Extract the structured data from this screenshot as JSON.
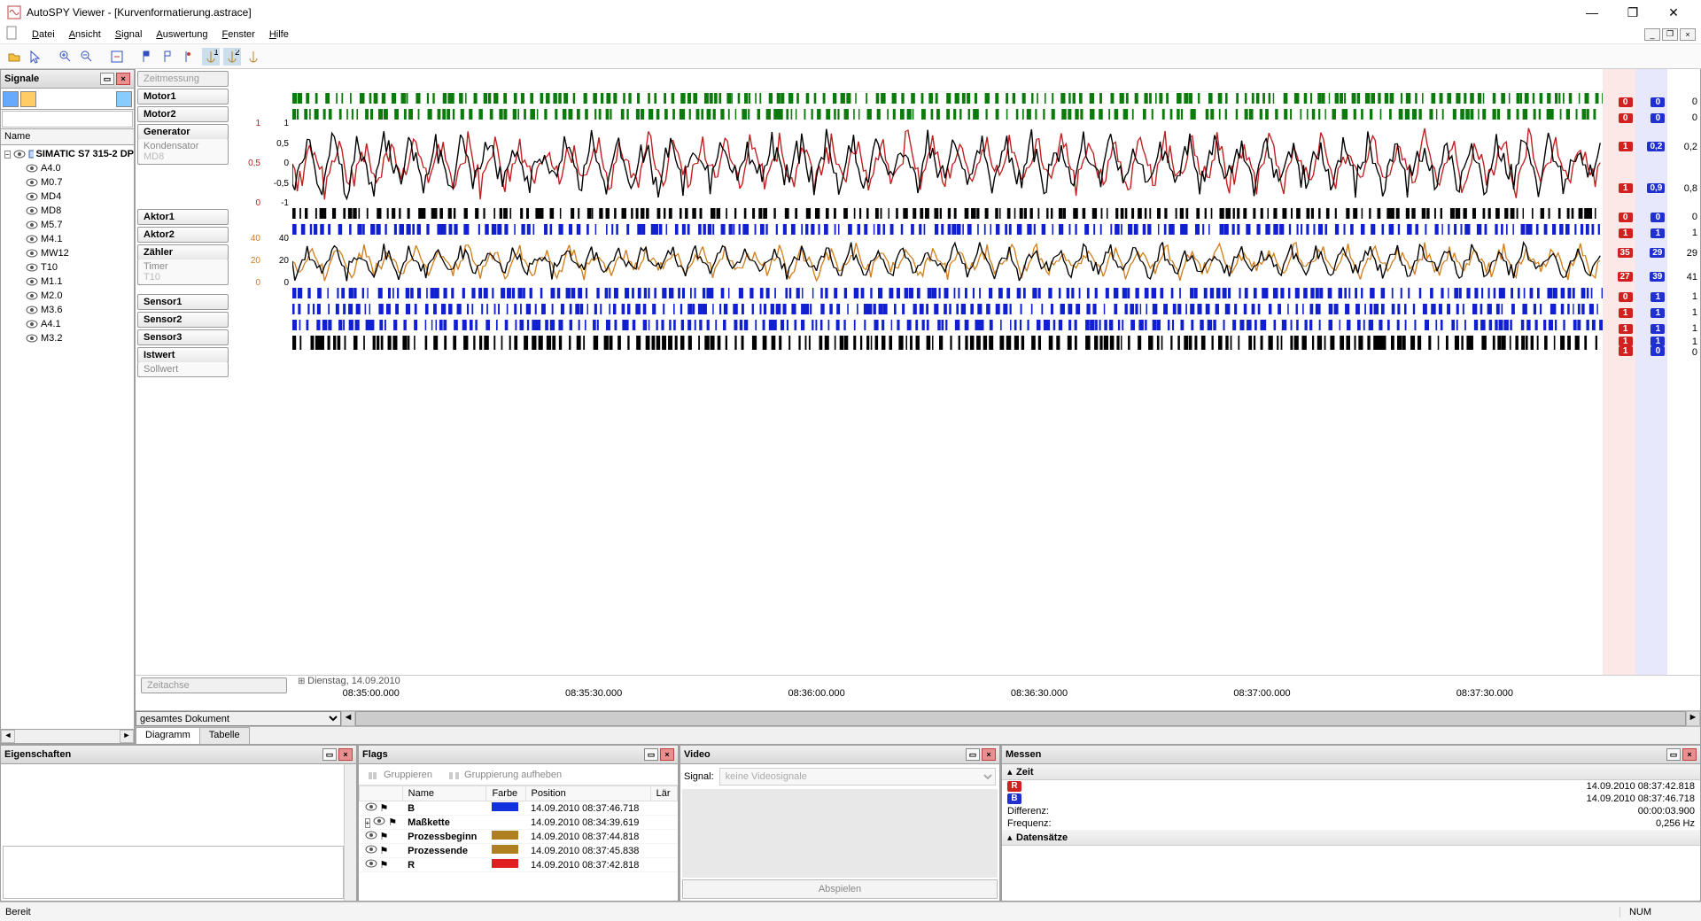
{
  "window": {
    "title": "AutoSPY Viewer - [Kurvenformatierung.astrace]"
  },
  "menu": [
    "Datei",
    "Ansicht",
    "Signal",
    "Auswertung",
    "Fenster",
    "Hilfe"
  ],
  "panels": {
    "signals": {
      "title": "Signale",
      "nameCol": "Name",
      "root": "SIMATIC S7 315-2 DP",
      "items": [
        "A4.0",
        "M0.7",
        "MD4",
        "MD8",
        "M5.7",
        "M4.1",
        "MW12",
        "T10",
        "M1.1",
        "M2.0",
        "M3.6",
        "A4.1",
        "M3.2"
      ]
    },
    "props": {
      "title": "Eigenschaften"
    },
    "flags": {
      "title": "Flags",
      "toolbar": {
        "group": "Gruppieren",
        "ungroup": "Gruppierung aufheben"
      },
      "cols": [
        "Name",
        "Farbe",
        "Position",
        "Lär"
      ],
      "rows": [
        {
          "name": "B",
          "color": "#1030e0",
          "pos": "14.09.2010  08:37:46.718"
        },
        {
          "name": "Maßkette",
          "color": "",
          "pos": "14.09.2010  08:34:39.619",
          "exp": true
        },
        {
          "name": "Prozessbeginn",
          "color": "#b08020",
          "pos": "14.09.2010  08:37:44.818"
        },
        {
          "name": "Prozessende",
          "color": "#b08020",
          "pos": "14.09.2010  08:37:45.838"
        },
        {
          "name": "R",
          "color": "#e02020",
          "pos": "14.09.2010  08:37:42.818"
        }
      ]
    },
    "video": {
      "title": "Video",
      "signalLbl": "Signal:",
      "noSignal": "keine Videosignale",
      "play": "Abspielen"
    },
    "mess": {
      "title": "Messen",
      "zeit": "Zeit",
      "r": {
        "label": "R",
        "val": "14.09.2010  08:37:42.818"
      },
      "b": {
        "label": "B",
        "val": "14.09.2010  08:37:46.718"
      },
      "diff": {
        "label": "Differenz:",
        "val": "00:00:03.900"
      },
      "freq": {
        "label": "Frequenz:",
        "val": "0,256 Hz"
      },
      "data": "Datensätze"
    }
  },
  "chart": {
    "zeitmessung": "Zeitmessung",
    "zeitachse": "Zeitachse",
    "dateLine": "Dienstag, 14.09.2010",
    "tracks": [
      {
        "label": "Motor1",
        "h": 14,
        "type": "dig",
        "color": "#0a7a0a",
        "vals": [
          "0",
          "0",
          "0"
        ]
      },
      {
        "label": "Motor2",
        "h": 14,
        "type": "dig",
        "color": "#0a7a0a",
        "vals": [
          "0",
          "0",
          "0"
        ]
      },
      {
        "label": "Generator",
        "sub": "Kondensator",
        "subnote": "MD8",
        "h": 90,
        "type": "ana",
        "axis": [
          "1",
          "0,5",
          "0",
          "-0,5",
          "-1"
        ],
        "axis2": [
          "1",
          "0,5",
          "0"
        ],
        "vals": [
          "1",
          "0,2",
          "0,2"
        ],
        "vals2": [
          "1",
          "0,9",
          "0,8"
        ]
      },
      {
        "label": "Aktor1",
        "h": 14,
        "type": "dig",
        "color": "#000",
        "vals": [
          "0",
          "0",
          "0"
        ]
      },
      {
        "label": "Aktor2",
        "h": 14,
        "type": "dig",
        "color": "#1020d0",
        "vals": [
          "1",
          "1",
          "1"
        ]
      },
      {
        "label": "Zähler",
        "sub": "Timer",
        "subnote": "T10",
        "h": 50,
        "type": "ana2",
        "axis": [
          "40",
          "20",
          "0"
        ],
        "axis2": [
          "40",
          "20",
          "0"
        ],
        "vals": [
          "35",
          "29",
          "29"
        ],
        "vals2": [
          "27",
          "39",
          "41"
        ]
      },
      {
        "label": "Sensor1",
        "h": 14,
        "type": "dig",
        "color": "#1020d0",
        "vals": [
          "0",
          "1",
          "1"
        ]
      },
      {
        "label": "Sensor2",
        "h": 14,
        "type": "dig",
        "color": "#1020d0",
        "vals": [
          "1",
          "1",
          "1"
        ]
      },
      {
        "label": "Sensor3",
        "h": 14,
        "type": "dig",
        "color": "#1020d0",
        "vals": [
          "1",
          "1",
          "1"
        ]
      },
      {
        "label": "Istwert",
        "sub": "Sollwert",
        "h": 18,
        "type": "dig2",
        "color": "#000",
        "vals": [
          "1",
          "1",
          "1"
        ],
        "vals2": [
          "1",
          "0",
          "0"
        ]
      }
    ],
    "ticks": [
      "08:35:00.000",
      "08:35:30.000",
      "08:36:00.000",
      "08:36:30.000",
      "08:37:00.000",
      "08:37:30.000"
    ],
    "rangeSel": "gesamtes Dokument",
    "tabs": [
      "Diagramm",
      "Tabelle"
    ]
  },
  "status": {
    "ready": "Bereit",
    "num": "NUM"
  }
}
